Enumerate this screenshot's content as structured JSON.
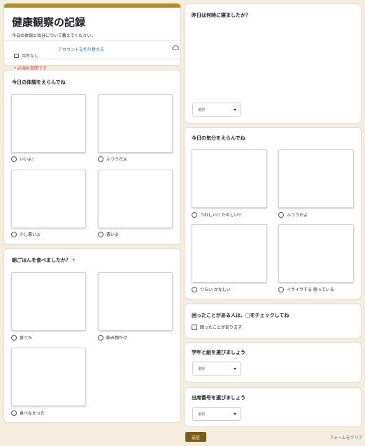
{
  "form": {
    "title": "健康観察の記録",
    "description": "今日の体調と気分について教えてください。",
    "switch_account": "アカウントを切り替える",
    "not_shared": "共有なし",
    "required_note": "* 必須の質問です"
  },
  "q_condition": {
    "label": "今日の体調をえらんでね",
    "options": [
      "いいよ!",
      "ふつうだよ",
      "少し悪いよ",
      "悪いよ"
    ]
  },
  "q_breakfast": {
    "label": "朝ごはんを食べましたか？",
    "required_mark": "*",
    "options": [
      "食べた",
      "飲み物だけ",
      "食べなかった"
    ]
  },
  "q_bedtime": {
    "label": "昨日は何時に寝ましたか？",
    "select_placeholder": "選択"
  },
  "q_mood": {
    "label": "今日の気分をえらんでね",
    "options": [
      "うれしい!! たのしい!!",
      "ふつうだよ",
      "つらい かなしい",
      "イライラする 怒っている"
    ]
  },
  "q_trouble": {
    "label": "困ったことがある人は、□をチェックしてね",
    "option": "困ったことがあります"
  },
  "q_grade": {
    "label": "学年と組を選びましょう",
    "select_placeholder": "選択"
  },
  "q_number": {
    "label": "出席番号を選びましょう",
    "select_placeholder": "選択"
  },
  "footer": {
    "submit": "送信",
    "clear": "フォームをクリア"
  },
  "colors": {
    "accent": "#b08f2a",
    "submit": "#7a5c14",
    "required": "#d93025",
    "link": "#1a73e8",
    "background": "#f3eee0"
  }
}
